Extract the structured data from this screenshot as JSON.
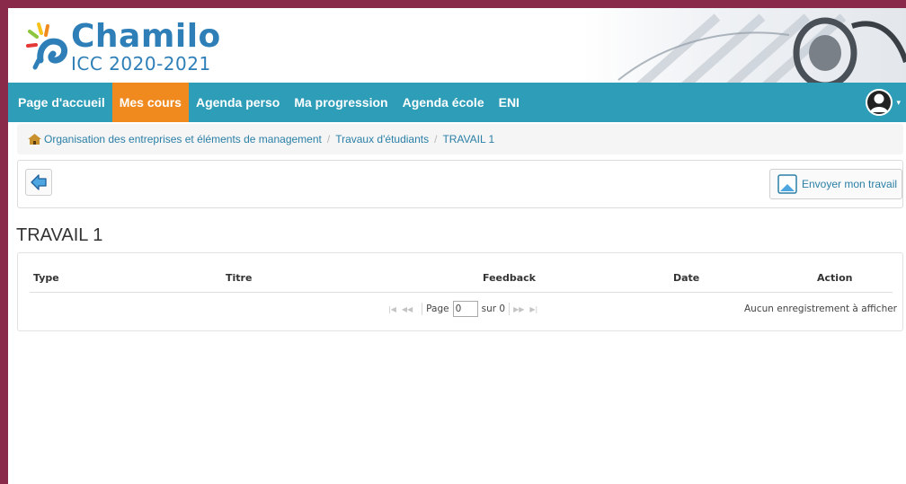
{
  "brand": {
    "name": "Chamilo",
    "subtitle": "ICC 2020-2021"
  },
  "nav": {
    "items": [
      {
        "label": "Page d'accueil",
        "active": false
      },
      {
        "label": "Mes cours",
        "active": true
      },
      {
        "label": "Agenda perso",
        "active": false
      },
      {
        "label": "Ma progression",
        "active": false
      },
      {
        "label": "Agenda école",
        "active": false
      },
      {
        "label": "ENI",
        "active": false
      }
    ],
    "user_caret": "▾"
  },
  "breadcrumb": {
    "items": [
      "Organisation des entreprises et éléments de management",
      "Travaux d'étudiants",
      "TRAVAIL 1"
    ],
    "separator": "/"
  },
  "toolbar": {
    "send_label": "Envoyer mon travail"
  },
  "page": {
    "title": "TRAVAIL 1"
  },
  "table": {
    "columns": [
      "Type",
      "Titre",
      "Feedback",
      "Date",
      "Action"
    ],
    "pager": {
      "page_label": "Page",
      "page_value": "0",
      "of_label": "sur 0"
    },
    "empty_message": "Aucun enregistrement à afficher"
  },
  "colors": {
    "navbar": "#2e9db8",
    "nav_active": "#f08a1f",
    "brand": "#2e7fb8",
    "link": "#2a7fa6",
    "frame": "#8a2a4a"
  },
  "icons": {
    "logo": "chamilo-logo-icon",
    "user": "user-avatar-icon",
    "home": "home-icon",
    "back": "back-arrow-icon",
    "send": "upload-icon"
  }
}
